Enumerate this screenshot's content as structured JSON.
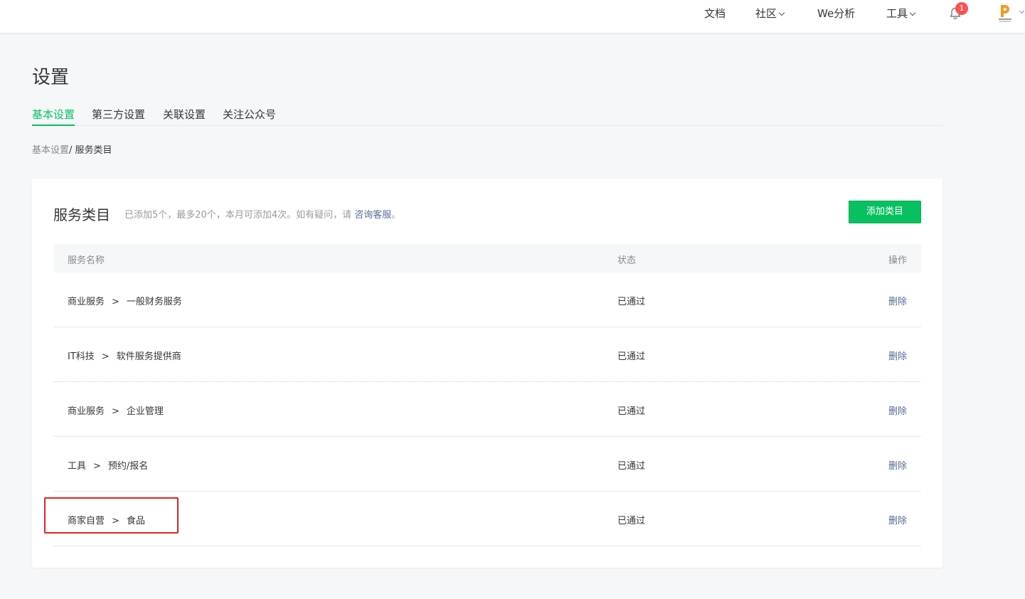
{
  "topnav": {
    "docs": "文档",
    "community": "社区",
    "analytics": "We分析",
    "tools": "工具",
    "notification_count": "1"
  },
  "page": {
    "title": "设置",
    "tabs": [
      "基本设置",
      "第三方设置",
      "关联设置",
      "关注公众号"
    ],
    "active_tab": "基本设置",
    "breadcrumb": {
      "parent": "基本设置",
      "separator": "/ ",
      "current": "服务类目"
    }
  },
  "card": {
    "title": "服务类目",
    "desc_prefix": "已添加5个，最多20个，本月可添加4次。如有疑问，请 ",
    "desc_link": "咨询客服",
    "desc_suffix": "。",
    "add_button": "添加类目"
  },
  "table": {
    "headers": {
      "name": "服务名称",
      "status": "状态",
      "action": "操作"
    },
    "rows": [
      {
        "category": "商业服务",
        "subcategory": "一般财务服务",
        "status": "已通过",
        "action": "删除"
      },
      {
        "category": "IT科技",
        "subcategory": "软件服务提供商",
        "status": "已通过",
        "action": "删除"
      },
      {
        "category": "商业服务",
        "subcategory": "企业管理",
        "status": "已通过",
        "action": "删除"
      },
      {
        "category": "工具",
        "subcategory": "预约/报名",
        "status": "已通过",
        "action": "删除"
      },
      {
        "category": "商家自营",
        "subcategory": "食品",
        "status": "已通过",
        "action": "删除"
      }
    ],
    "arrow": ">"
  },
  "colors": {
    "brand_green": "#07c160",
    "link_blue": "#576b95",
    "badge_red": "#fa5151",
    "highlight_red": "#e1251b"
  },
  "icons": {
    "bell": "bell-icon",
    "avatar": "avatar-logo",
    "caret": "chevron-down-icon"
  }
}
